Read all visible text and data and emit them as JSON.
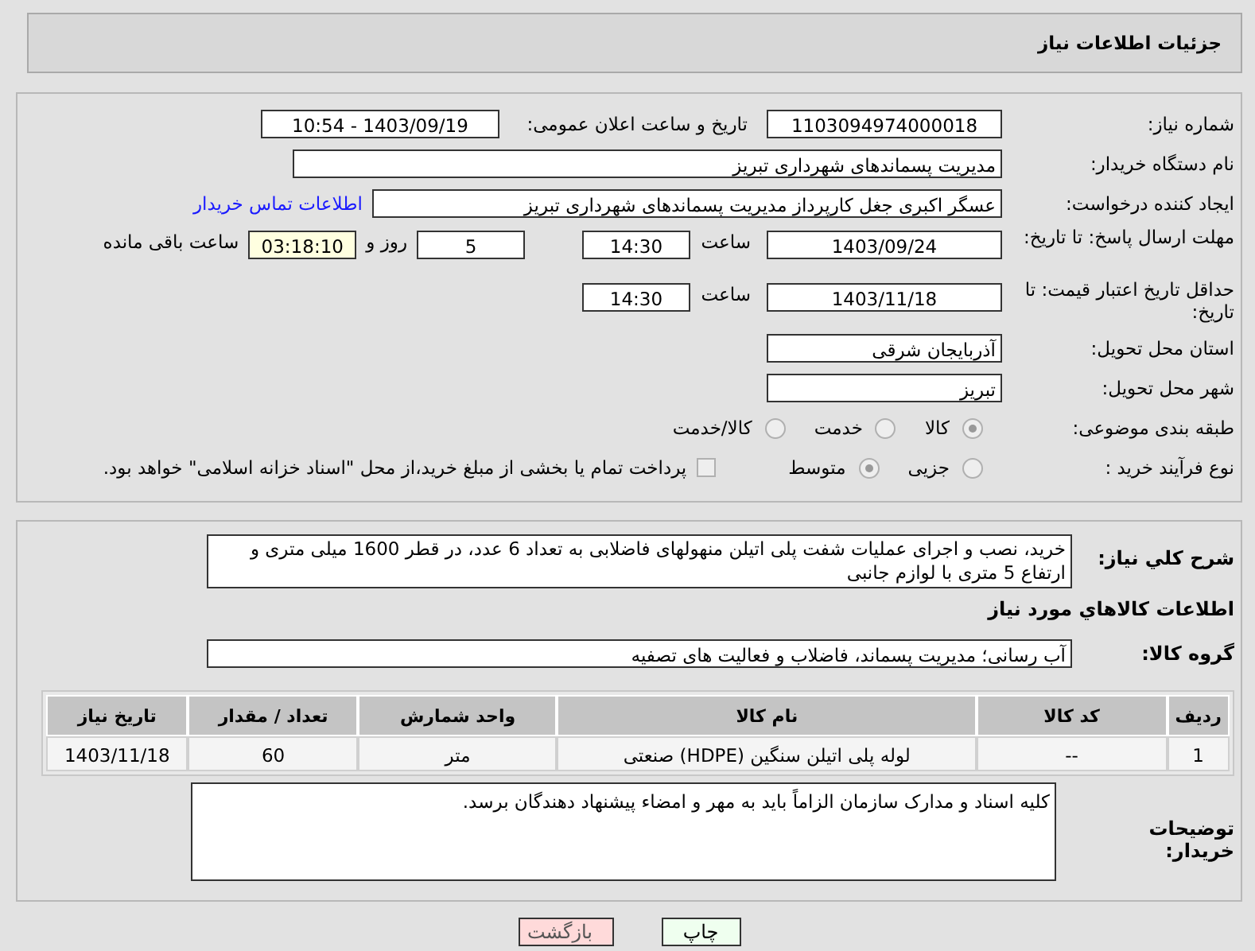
{
  "header": {
    "title": "جزئیات اطلاعات نیاز"
  },
  "need_number": {
    "label": "شماره نیاز:",
    "value": "1103094974000018"
  },
  "announce": {
    "label": "تاریخ و ساعت اعلان عمومی:",
    "value": "1403/09/19 - 10:54"
  },
  "buyer_org": {
    "label": "نام دستگاه خریدار:",
    "value": "مدیریت پسماندهای شهرداری تبریز"
  },
  "requester": {
    "label": "ایجاد کننده درخواست:",
    "value": "عسگر اکبری جغل کارپرداز مدیریت پسماندهای شهرداری تبریز",
    "contact_link": "اطلاعات تماس خریدار"
  },
  "reply_deadline": {
    "label": "مهلت ارسال پاسخ: تا تاریخ:",
    "date": "1403/09/24",
    "time_label": "ساعت",
    "time": "14:30",
    "days": "5",
    "days_label": "روز و",
    "remaining": "03:18:10",
    "remaining_label": "ساعت باقی مانده"
  },
  "price_validity": {
    "label": "حداقل تاریخ اعتبار قیمت: تا تاریخ:",
    "date": "1403/11/18",
    "time_label": "ساعت",
    "time": "14:30"
  },
  "province": {
    "label": "استان محل تحویل:",
    "value": "آذربایجان شرقی"
  },
  "city": {
    "label": "شهر محل تحویل:",
    "value": "تبریز"
  },
  "category": {
    "label": "طبقه بندی موضوعی:",
    "options": [
      {
        "label": "کالا",
        "selected": true
      },
      {
        "label": "خدمت",
        "selected": false
      },
      {
        "label": "کالا/خدمت",
        "selected": false
      }
    ]
  },
  "purchase_type": {
    "label": "نوع فرآیند خرید :",
    "options": [
      {
        "label": "جزیی",
        "selected": false
      },
      {
        "label": "متوسط",
        "selected": true
      }
    ],
    "payment": {
      "checked": false,
      "label": "پرداخت تمام یا بخشی از مبلغ خرید،از محل \"اسناد خزانه اسلامی\" خواهد بود."
    }
  },
  "description": {
    "label": "شرح کلي نياز:",
    "value": "خرید، نصب و اجرای عملیات شفت پلی اتیلن منهولهای فاضلابی به تعداد 6 عدد، در قطر 1600 میلی متری و ارتفاع 5 متری با لوازم جانبی"
  },
  "goods_title": "اطلاعات کالاهاي مورد نياز",
  "goods_group": {
    "label": "گروه کالا:",
    "value": "آب رسانی؛ مدیریت پسماند، فاضلاب و فعالیت های تصفیه"
  },
  "table": {
    "columns": [
      "ردیف",
      "کد کالا",
      "نام کالا",
      "واحد شمارش",
      "تعداد / مقدار",
      "تاریخ نیاز"
    ],
    "rows": [
      [
        "1",
        "--",
        "لوله پلی اتیلن سنگین (HDPE) صنعتی",
        "متر",
        "60",
        "1403/11/18"
      ]
    ]
  },
  "buyer_notes": {
    "label": "توضیحات خریدار:",
    "value": "کلیه اسناد و مدارک سازمان الزاماً باید به مهر و امضاء پیشنهاد دهندگان  برسد."
  },
  "buttons": [
    {
      "label": "چاپ",
      "kind": "print"
    },
    {
      "label": "بازگشت",
      "kind": "back"
    }
  ]
}
